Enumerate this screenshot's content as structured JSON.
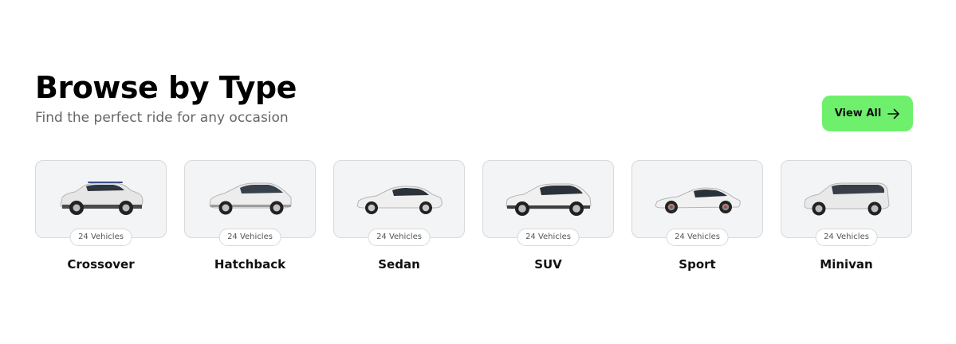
{
  "header": {
    "title": "Browse by Type",
    "subtitle": "Find the perfect ride for any occasion",
    "view_all_label": "View All",
    "view_all_icon": "arrow-right-icon",
    "accent_color": "#6ff06d"
  },
  "types": [
    {
      "name": "Crossover",
      "count": "24 Vehicles",
      "icon": "crossover-car-image"
    },
    {
      "name": "Hatchback",
      "count": "24 Vehicles",
      "icon": "hatchback-car-image"
    },
    {
      "name": "Sedan",
      "count": "24 Vehicles",
      "icon": "sedan-car-image"
    },
    {
      "name": "SUV",
      "count": "24 Vehicles",
      "icon": "suv-car-image"
    },
    {
      "name": "Sport",
      "count": "24 Vehicles",
      "icon": "sport-car-image"
    },
    {
      "name": "Minivan",
      "count": "24 Vehicles",
      "icon": "minivan-car-image"
    }
  ]
}
